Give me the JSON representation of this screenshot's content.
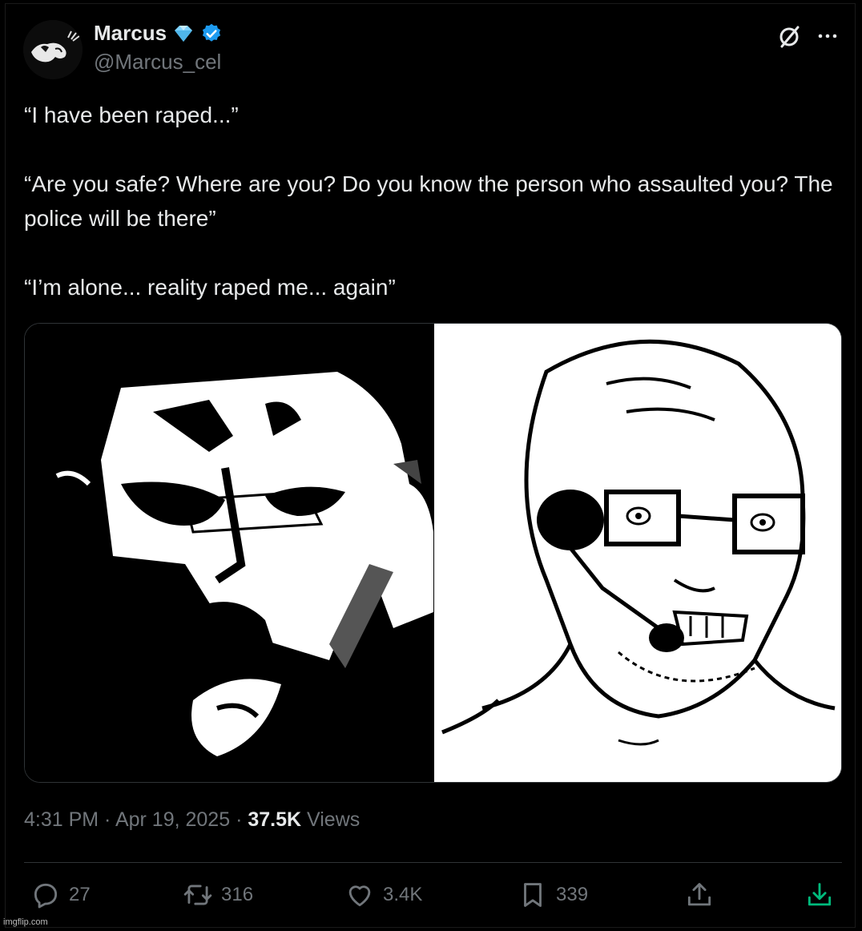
{
  "author": {
    "name": "Marcus",
    "handle": "@Marcus_cel",
    "verified": true,
    "badge_icon": "diamond-icon"
  },
  "tweet": {
    "lines": [
      "“I have been raped...”",
      "“Are you safe? Where are you? Do you know the person who assaulted you? The police will be there”",
      "“I’m alone... reality raped me... again”"
    ]
  },
  "meta": {
    "time": "4:31 PM",
    "sep1": " · ",
    "date": "Apr 19, 2025",
    "sep2": " · ",
    "views_count": "37.5K",
    "views_label": " Views"
  },
  "actions": {
    "replies": "27",
    "reposts": "316",
    "likes": "3.4K",
    "bookmarks": "339"
  },
  "watermark": "imgflip.com",
  "colors": {
    "background": "#000000",
    "text": "#e7e9ea",
    "muted": "#71767b",
    "verified": "#1d9bf0",
    "diamond": "#7fd3ff",
    "download": "#00ba7c"
  }
}
